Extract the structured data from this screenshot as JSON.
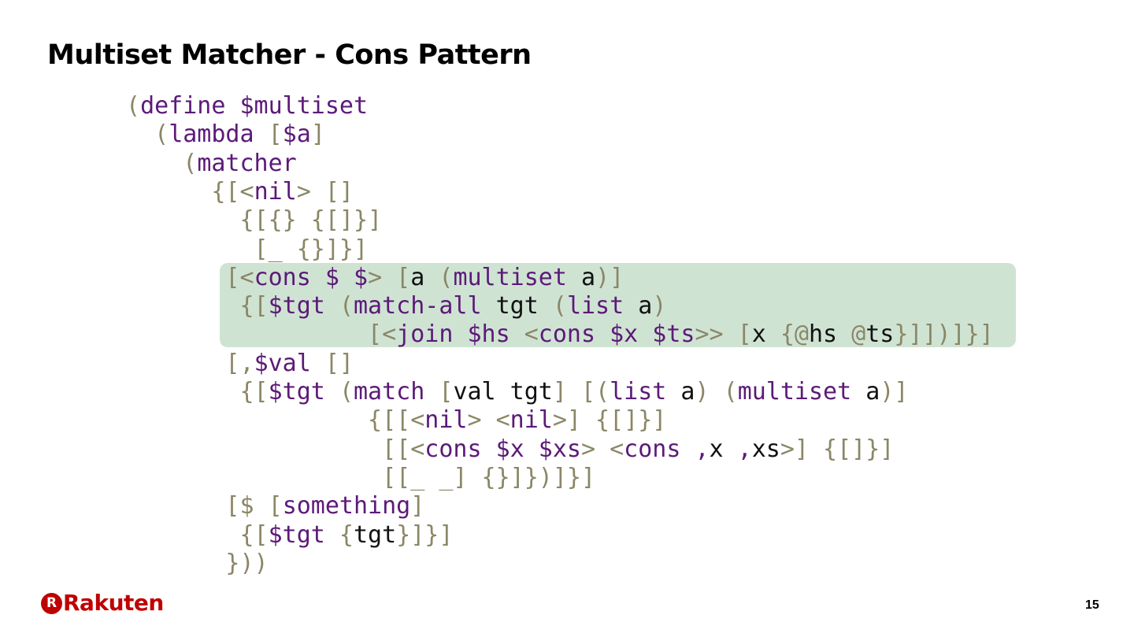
{
  "slide": {
    "title": "Multiset Matcher - Cons Pattern",
    "page_number": "15",
    "logo": {
      "text": "Rakuten",
      "badge_letter": "R",
      "color": "#bf0000"
    },
    "highlight_color": "#cfe3d3"
  },
  "code_lines": [
    [
      [
        "b",
        "("
      ],
      [
        "k",
        "define"
      ],
      [
        "v",
        " "
      ],
      [
        "k",
        "$multiset"
      ]
    ],
    [
      [
        "b",
        "  ("
      ],
      [
        "k",
        "lambda"
      ],
      [
        "v",
        " "
      ],
      [
        "b",
        "["
      ],
      [
        "k",
        "$a"
      ],
      [
        "b",
        "]"
      ]
    ],
    [
      [
        "b",
        "    ("
      ],
      [
        "k",
        "matcher"
      ]
    ],
    [
      [
        "b",
        "      {[<"
      ],
      [
        "k",
        "nil"
      ],
      [
        "b",
        "> []"
      ]
    ],
    [
      [
        "b",
        "        {[{} {[]}]"
      ]
    ],
    [
      [
        "b",
        "         [_ {}]}]"
      ]
    ],
    [
      [
        "b",
        "       [<"
      ],
      [
        "k",
        "cons"
      ],
      [
        "v",
        " "
      ],
      [
        "k",
        "$"
      ],
      [
        "v",
        " "
      ],
      [
        "k",
        "$"
      ],
      [
        "b",
        "> ["
      ],
      [
        "v",
        "a "
      ],
      [
        "b",
        "("
      ],
      [
        "k",
        "multiset"
      ],
      [
        "v",
        " a"
      ],
      [
        "b",
        ")]"
      ]
    ],
    [
      [
        "b",
        "        {["
      ],
      [
        "k",
        "$tgt"
      ],
      [
        "v",
        " "
      ],
      [
        "b",
        "("
      ],
      [
        "k",
        "match-all"
      ],
      [
        "v",
        " tgt "
      ],
      [
        "b",
        "("
      ],
      [
        "k",
        "list"
      ],
      [
        "v",
        " a"
      ],
      [
        "b",
        ")"
      ]
    ],
    [
      [
        "b",
        "                 [<"
      ],
      [
        "k",
        "join"
      ],
      [
        "v",
        " "
      ],
      [
        "k",
        "$hs"
      ],
      [
        "v",
        " "
      ],
      [
        "b",
        "<"
      ],
      [
        "k",
        "cons"
      ],
      [
        "v",
        " "
      ],
      [
        "k",
        "$x"
      ],
      [
        "v",
        " "
      ],
      [
        "k",
        "$ts"
      ],
      [
        "b",
        ">> ["
      ],
      [
        "v",
        "x "
      ],
      [
        "b",
        "{@"
      ],
      [
        "v",
        "hs "
      ],
      [
        "b",
        "@"
      ],
      [
        "v",
        "ts"
      ],
      [
        "b",
        "}]])]}]"
      ]
    ],
    [
      [
        "b",
        "       [,"
      ],
      [
        "k",
        "$val"
      ],
      [
        "b",
        " []"
      ]
    ],
    [
      [
        "b",
        "        {["
      ],
      [
        "k",
        "$tgt"
      ],
      [
        "v",
        " "
      ],
      [
        "b",
        "("
      ],
      [
        "k",
        "match"
      ],
      [
        "v",
        " "
      ],
      [
        "b",
        "["
      ],
      [
        "v",
        "val tgt"
      ],
      [
        "b",
        "] [("
      ],
      [
        "k",
        "list"
      ],
      [
        "v",
        " a"
      ],
      [
        "b",
        ") ("
      ],
      [
        "k",
        "multiset"
      ],
      [
        "v",
        " a"
      ],
      [
        "b",
        ")]"
      ]
    ],
    [
      [
        "b",
        "                 {[[<"
      ],
      [
        "k",
        "nil"
      ],
      [
        "b",
        "> <"
      ],
      [
        "k",
        "nil"
      ],
      [
        "b",
        ">] {[]}]"
      ]
    ],
    [
      [
        "b",
        "                  [[<"
      ],
      [
        "k",
        "cons"
      ],
      [
        "v",
        " "
      ],
      [
        "k",
        "$x"
      ],
      [
        "v",
        " "
      ],
      [
        "k",
        "$xs"
      ],
      [
        "b",
        "> <"
      ],
      [
        "k",
        "cons"
      ],
      [
        "v",
        " "
      ],
      [
        "k",
        ","
      ],
      [
        "v",
        "x "
      ],
      [
        "k",
        ","
      ],
      [
        "v",
        "xs"
      ],
      [
        "b",
        ">] {[]}]"
      ]
    ],
    [
      [
        "b",
        "                  [[_ _] {}]})]}]"
      ]
    ],
    [
      [
        "b",
        "       [$ ["
      ],
      [
        "k",
        "something"
      ],
      [
        "b",
        "]"
      ]
    ],
    [
      [
        "b",
        "        {["
      ],
      [
        "k",
        "$tgt"
      ],
      [
        "b",
        " {"
      ],
      [
        "v",
        "tgt"
      ],
      [
        "b",
        "}]}]"
      ]
    ],
    [
      [
        "b",
        "       }))"
      ]
    ]
  ]
}
